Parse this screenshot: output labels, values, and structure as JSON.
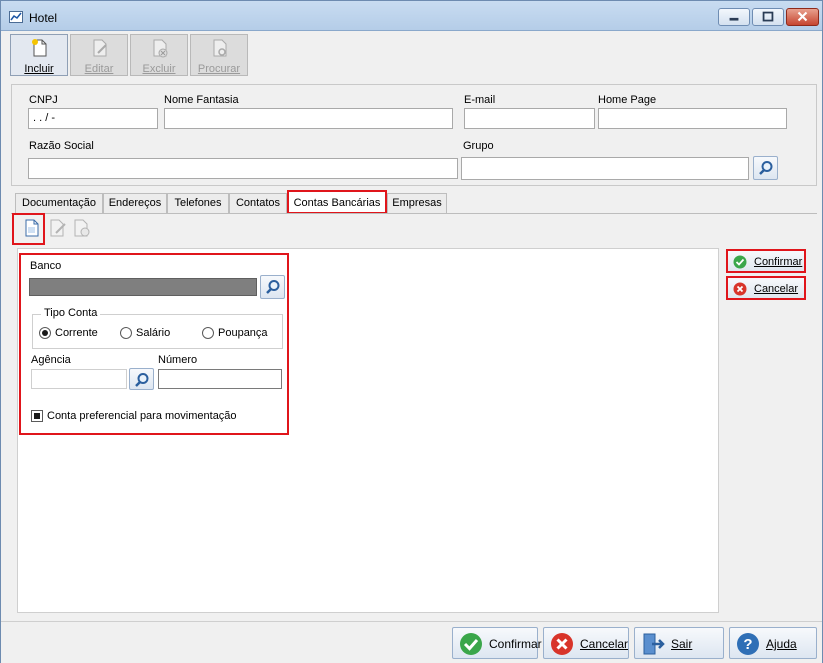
{
  "window": {
    "title": "Hotel"
  },
  "toolbar": {
    "buttons": [
      {
        "label": "Incluir",
        "icon": "new-document-icon",
        "enabled": true
      },
      {
        "label": "Editar",
        "icon": "edit-document-icon",
        "enabled": false
      },
      {
        "label": "Excluir",
        "icon": "delete-document-icon",
        "enabled": false
      },
      {
        "label": "Procurar",
        "icon": "search-document-icon",
        "enabled": false
      }
    ]
  },
  "fields": {
    "cnpj": {
      "label": "CNPJ",
      "value": ".   .   /   -"
    },
    "nome_fantasia": {
      "label": "Nome Fantasia",
      "value": ""
    },
    "email": {
      "label": "E-mail",
      "value": ""
    },
    "home_page": {
      "label": "Home Page",
      "value": ""
    },
    "razao_social": {
      "label": "Razão Social",
      "value": ""
    },
    "grupo": {
      "label": "Grupo",
      "value": ""
    }
  },
  "tabs": [
    {
      "label": "Documentação",
      "active": false
    },
    {
      "label": "Endereços",
      "active": false
    },
    {
      "label": "Telefones",
      "active": false
    },
    {
      "label": "Contatos",
      "active": false
    },
    {
      "label": "Contas Bancárias",
      "active": true
    },
    {
      "label": "Empresas",
      "active": false
    }
  ],
  "bank_form": {
    "banco_label": "Banco",
    "tipo_conta": {
      "title": "Tipo Conta",
      "options": [
        {
          "label": "Corrente",
          "selected": true
        },
        {
          "label": "Salário",
          "selected": false
        },
        {
          "label": "Poupança",
          "selected": false
        }
      ]
    },
    "agencia_label": "Agência",
    "numero_label": "Número",
    "preferencial_label": "Conta preferencial para movimentação",
    "preferencial_checked": true
  },
  "side_buttons": {
    "confirm": "Confirmar",
    "cancel": "Cancelar"
  },
  "bottom_buttons": {
    "confirm": "Confirmar",
    "cancel": "Cancelar",
    "exit": "Sair",
    "help": "Ajuda"
  },
  "colors": {
    "highlight": "#e0151b",
    "confirm_green": "#3aa64a",
    "cancel_red": "#d8342a",
    "help_blue": "#2f6fb6"
  }
}
